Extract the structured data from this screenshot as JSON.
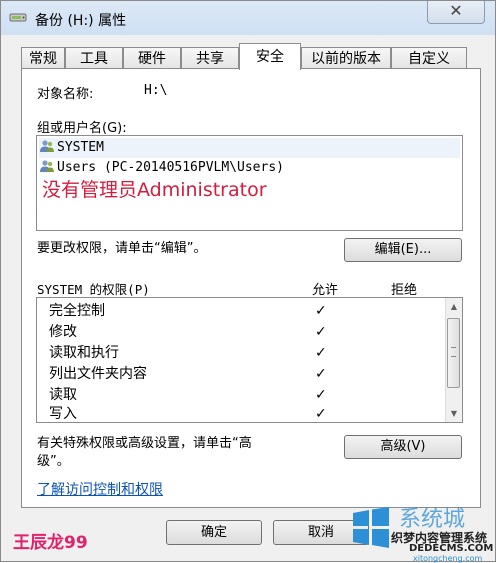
{
  "window": {
    "title": "备份 (H:) 属性",
    "close_symbol": "✕",
    "icon": "drive-icon"
  },
  "tabs": [
    {
      "label": "常规"
    },
    {
      "label": "工具"
    },
    {
      "label": "硬件"
    },
    {
      "label": "共享"
    },
    {
      "label": "安全",
      "active": true
    },
    {
      "label": "以前的版本"
    },
    {
      "label": "自定义"
    }
  ],
  "security": {
    "object_label": "对象名称:",
    "object_value": "H:\\",
    "group_label": "组或用户名(G):",
    "users": [
      {
        "name": "SYSTEM",
        "icon": "user-group-icon",
        "selected": true
      },
      {
        "name": "Users (PC-20140516PVLM\\Users)",
        "icon": "user-group-icon",
        "selected": false
      }
    ],
    "annotation": "没有管理员Administrator",
    "change_hint": "要更改权限，请单击“编辑”。",
    "edit_button": "编辑(E)...",
    "perm_header": "SYSTEM 的权限(P)",
    "allow_header": "允许",
    "deny_header": "拒绝",
    "permissions": [
      {
        "name": "完全控制",
        "allow": "✓"
      },
      {
        "name": "修改",
        "allow": "✓"
      },
      {
        "name": "读取和执行",
        "allow": "✓"
      },
      {
        "name": "列出文件夹内容",
        "allow": "✓"
      },
      {
        "name": "读取",
        "allow": "✓"
      },
      {
        "name": "写入",
        "allow": "✓"
      }
    ],
    "advanced_hint_line1": "有关特殊权限或高级设置，请单击“高",
    "advanced_hint_line2": "级”。",
    "advanced_button": "高级(V)",
    "learn_link": "了解访问控制和权限"
  },
  "footer": {
    "ok_button": "确定",
    "cancel_button": "取消"
  },
  "watermarks": {
    "left": "王辰龙99",
    "logo_text": "系统城",
    "logo_sub": "织梦内容管理系统",
    "logo_domain": "DEDECMS.COM",
    "logo_url": "xitongcheng.com"
  },
  "colors": {
    "annotation": "#d21d3c",
    "link": "#0b53b5",
    "watermark": "#e0226a"
  }
}
